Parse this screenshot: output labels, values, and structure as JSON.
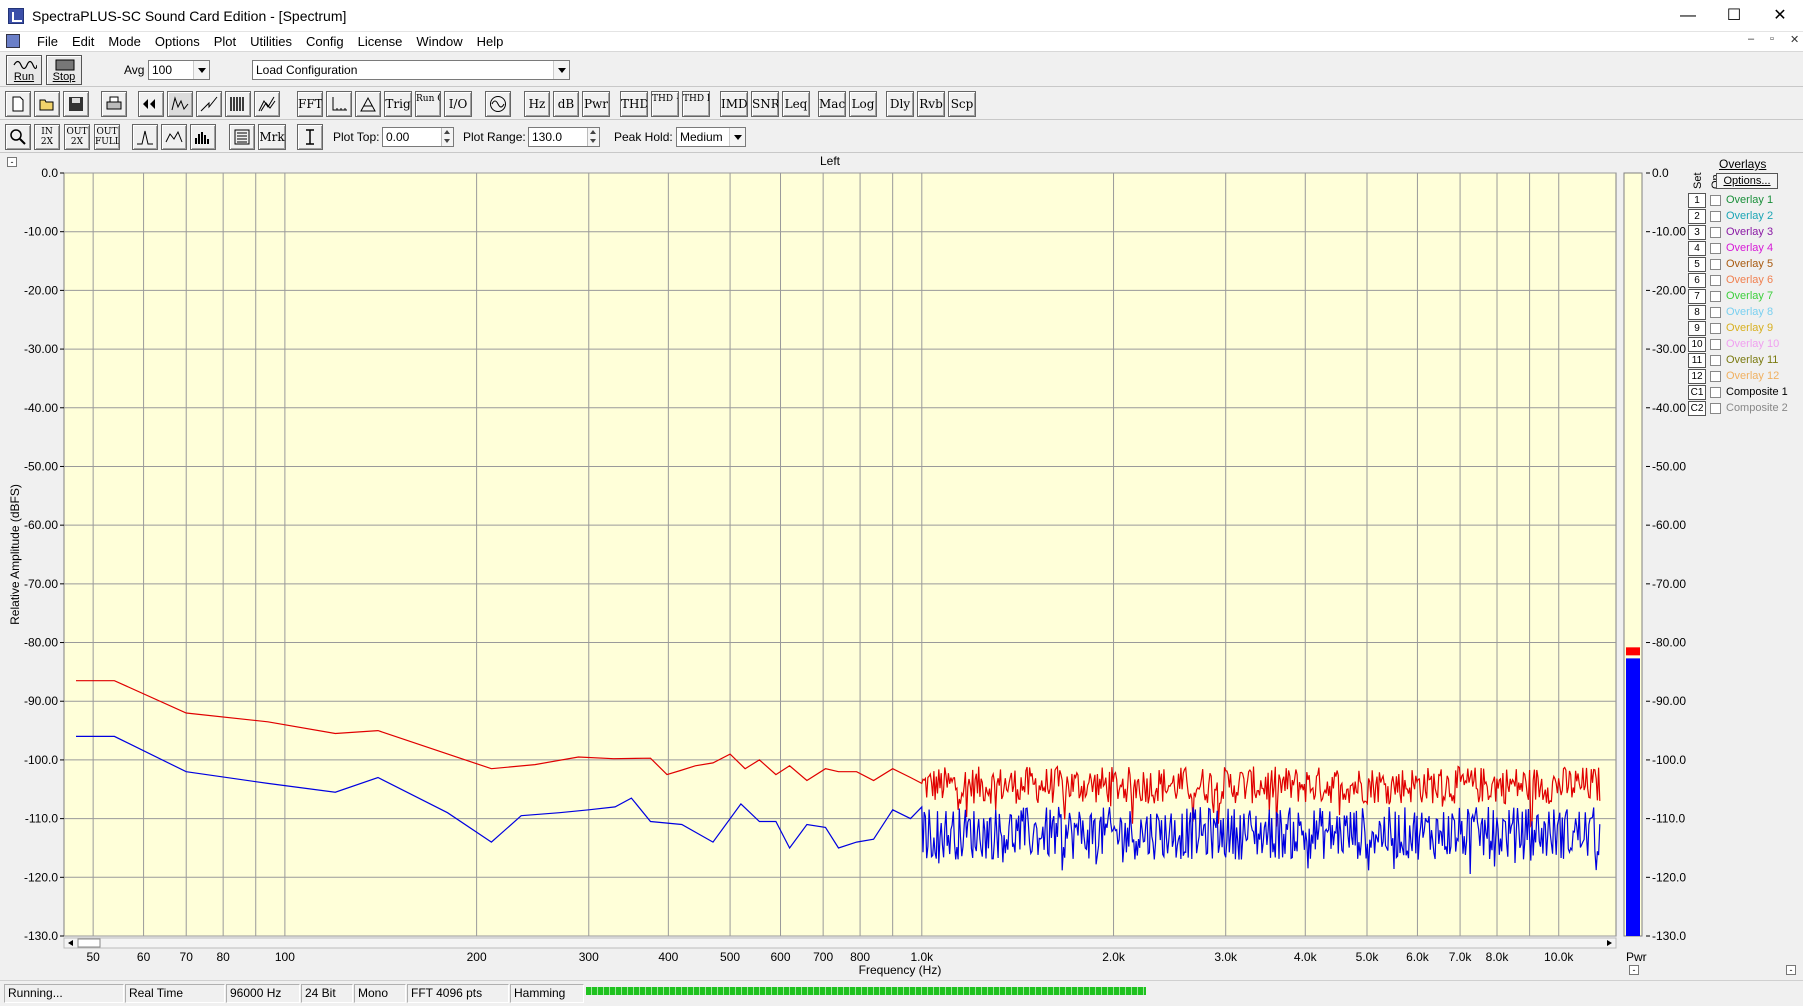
{
  "window": {
    "title": "SpectraPLUS-SC Sound Card Edition - [Spectrum]",
    "minimize_glyph": "—",
    "maximize_glyph": "☐",
    "close_glyph": "✕"
  },
  "menu": [
    "File",
    "Edit",
    "Mode",
    "Options",
    "Plot",
    "Utilities",
    "Config",
    "License",
    "Window",
    "Help"
  ],
  "mdi_controls": [
    "–",
    "▫",
    "✕"
  ],
  "toolbar": {
    "run_label": "Run",
    "stop_label": "Stop",
    "avg_label": "Avg",
    "avg_value": "100",
    "config_value": "Load Configuration",
    "row2_text_buttons": [
      "FFT",
      "Trig",
      "Run Ctrl",
      "I/O",
      "Hz",
      "dB",
      "Pwr",
      "THD",
      "THD +N",
      "THD Freq",
      "IMD",
      "SNR",
      "Leq",
      "Mac",
      "Log",
      "Dly",
      "Rvb",
      "Scp"
    ],
    "zoom_buttons": [
      "2X",
      "2X",
      "FULL"
    ],
    "zoom_prefix": [
      "IN",
      "OUT",
      "OUT"
    ],
    "mrk_label": "Mrk",
    "plot_top_label": "Plot Top:",
    "plot_top_value": "0.00",
    "plot_range_label": "Plot Range:",
    "plot_range_value": "130.0",
    "peak_hold_label": "Peak Hold:",
    "peak_hold_value": "Medium"
  },
  "overlays": {
    "header": "Overlays",
    "set_label": "Set",
    "on_label": "On",
    "options_label": "Options...",
    "items": [
      {
        "num": "1",
        "name": "Overlay 1",
        "color": "#1a8f3a"
      },
      {
        "num": "2",
        "name": "Overlay 2",
        "color": "#1aa5b5"
      },
      {
        "num": "3",
        "name": "Overlay 3",
        "color": "#8a1aa5"
      },
      {
        "num": "4",
        "name": "Overlay 4",
        "color": "#d61ad6"
      },
      {
        "num": "5",
        "name": "Overlay 5",
        "color": "#a85a10"
      },
      {
        "num": "6",
        "name": "Overlay 6",
        "color": "#f08050"
      },
      {
        "num": "7",
        "name": "Overlay 7",
        "color": "#3ccf3c"
      },
      {
        "num": "8",
        "name": "Overlay 8",
        "color": "#7ad0f0"
      },
      {
        "num": "9",
        "name": "Overlay 9",
        "color": "#d8b020"
      },
      {
        "num": "10",
        "name": "Overlay 10",
        "color": "#f0a0f0"
      },
      {
        "num": "11",
        "name": "Overlay 11",
        "color": "#7a7a10"
      },
      {
        "num": "12",
        "name": "Overlay 12",
        "color": "#f0b060"
      },
      {
        "num": "C1",
        "name": "Composite 1",
        "color": "#000000"
      },
      {
        "num": "C2",
        "name": "Composite 2",
        "color": "#888888"
      }
    ]
  },
  "status": {
    "cells": [
      "Running...",
      "Real Time",
      "96000 Hz",
      "24 Bit",
      "Mono",
      "FFT 4096 pts",
      "Hamming"
    ]
  },
  "chart_data": {
    "type": "line",
    "title": "Left",
    "xlabel": "Frequency (Hz)",
    "ylabel": "Relative Amplitude (dBFS)",
    "xscale": "log",
    "xlim": [
      45,
      12300
    ],
    "ylim": [
      -130,
      0
    ],
    "grid": true,
    "plot_bg": "#ffffd9",
    "x_tick_labels": [
      "50",
      "60",
      "70",
      "80",
      "100",
      "200",
      "300",
      "400",
      "500",
      "600",
      "700",
      "800",
      "1.0k",
      "2.0k",
      "3.0k",
      "4.0k",
      "5.0k",
      "6.0k",
      "7.0k",
      "8.0k",
      "10.0k"
    ],
    "x_tick_values": [
      50,
      60,
      70,
      80,
      100,
      200,
      300,
      400,
      500,
      600,
      700,
      800,
      1000,
      2000,
      3000,
      4000,
      5000,
      6000,
      7000,
      8000,
      10000
    ],
    "y_tick_labels": [
      "0.0",
      "-10.00",
      "-20.00",
      "-30.00",
      "-40.00",
      "-50.00",
      "-60.00",
      "-70.00",
      "-80.00",
      "-90.00",
      "-100.0",
      "-110.0",
      "-120.0",
      "-130.0"
    ],
    "y_tick_values": [
      0,
      -10,
      -20,
      -30,
      -40,
      -50,
      -60,
      -70,
      -80,
      -90,
      -100,
      -110,
      -120,
      -130
    ],
    "series": [
      {
        "color": "#e00000",
        "x": [
          47,
          54,
          70,
          94,
          120,
          140,
          211,
          247,
          289,
          328,
          375,
          398,
          418,
          441,
          470,
          500,
          528,
          556,
          590,
          620,
          660,
          706,
          740,
          790,
          840,
          900,
          960,
          1000
        ],
        "y": [
          -86.5,
          -86.5,
          -92,
          -93.5,
          -95.5,
          -95,
          -101.5,
          -100.8,
          -99.5,
          -99.8,
          -99.7,
          -102.5,
          -101.8,
          -101,
          -100.5,
          -99,
          -101.5,
          -100,
          -102.5,
          -101,
          -103.5,
          -101.5,
          -102,
          -102,
          -103.5,
          -101.5,
          -103,
          -104
        ]
      },
      {
        "color": "#0000e0",
        "x": [
          47,
          54,
          70,
          94,
          120,
          140,
          180,
          211,
          235,
          270,
          300,
          330,
          350,
          375,
          420,
          470,
          520,
          556,
          590,
          620,
          660,
          706,
          740,
          790,
          840,
          900,
          960,
          1000
        ],
        "y": [
          -96,
          -96,
          -102,
          -104,
          -105.5,
          -103,
          -109,
          -114,
          -109.5,
          -109,
          -108.5,
          -108,
          -106.5,
          -110.5,
          -111,
          -114,
          -107.5,
          -110.5,
          -110.5,
          -115,
          -111,
          -111.5,
          -115,
          -114,
          -113.5,
          -108.5,
          -110,
          -108
        ]
      }
    ],
    "noise_series": [
      {
        "color": "#e00000",
        "x_start": 1000,
        "x_end": 11600,
        "mean": -104.3,
        "amplitude": 3.2,
        "dip_min": -111.5
      },
      {
        "color": "#0000e0",
        "x_start": 1000,
        "x_end": 11600,
        "mean": -112.5,
        "amplitude": 4.5,
        "dip_min": -119.5
      }
    ],
    "meter": {
      "label": "Pwr",
      "value": -82.7,
      "peak": -81.5,
      "bar_color": "#0000ff",
      "peak_color": "#ff0000"
    }
  }
}
